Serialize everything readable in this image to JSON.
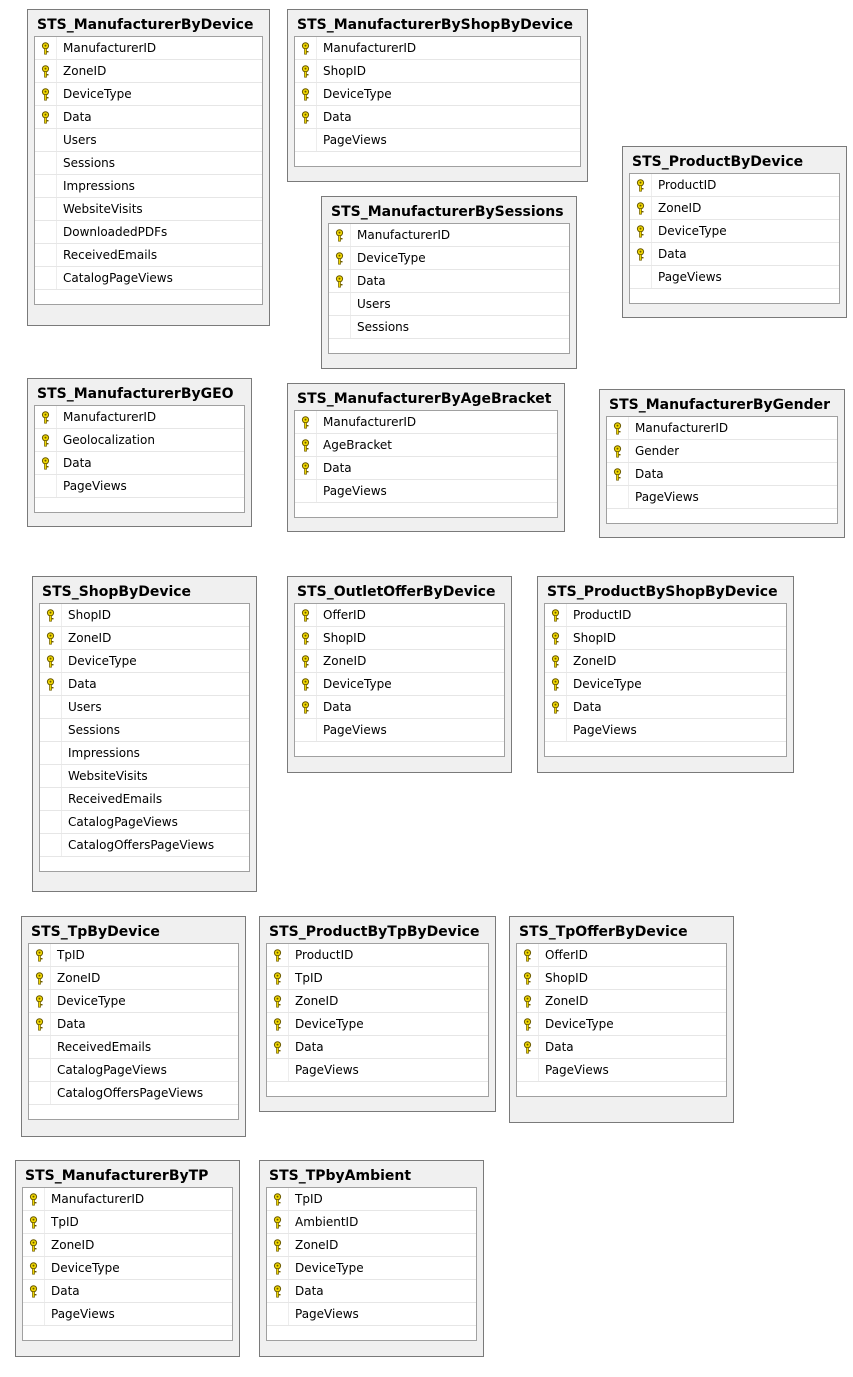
{
  "colors": {
    "key_fill": "#f2d900",
    "key_stroke": "#6b5a00"
  },
  "tables": [
    {
      "name": "STS_ManufacturerByDevice",
      "columns": [
        {
          "name": "ManufacturerID",
          "pk": true
        },
        {
          "name": "ZoneID",
          "pk": true
        },
        {
          "name": "DeviceType",
          "pk": true
        },
        {
          "name": "Data",
          "pk": true
        },
        {
          "name": "Users",
          "pk": false
        },
        {
          "name": "Sessions",
          "pk": false
        },
        {
          "name": "Impressions",
          "pk": false
        },
        {
          "name": "WebsiteVisits",
          "pk": false
        },
        {
          "name": "DownloadedPDFs",
          "pk": false
        },
        {
          "name": "ReceivedEmails",
          "pk": false
        },
        {
          "name": "CatalogPageViews",
          "pk": false
        }
      ]
    },
    {
      "name": "STS_ManufacturerByShopByDevice",
      "columns": [
        {
          "name": "ManufacturerID",
          "pk": true
        },
        {
          "name": "ShopID",
          "pk": true
        },
        {
          "name": "DeviceType",
          "pk": true
        },
        {
          "name": "Data",
          "pk": true
        },
        {
          "name": "PageViews",
          "pk": false
        }
      ]
    },
    {
      "name": "STS_ProductByDevice",
      "columns": [
        {
          "name": "ProductID",
          "pk": true
        },
        {
          "name": "ZoneID",
          "pk": true
        },
        {
          "name": "DeviceType",
          "pk": true
        },
        {
          "name": "Data",
          "pk": true
        },
        {
          "name": "PageViews",
          "pk": false
        }
      ]
    },
    {
      "name": "STS_ManufacturerBySessions",
      "columns": [
        {
          "name": "ManufacturerID",
          "pk": true
        },
        {
          "name": "DeviceType",
          "pk": true
        },
        {
          "name": "Data",
          "pk": true
        },
        {
          "name": "Users",
          "pk": false
        },
        {
          "name": "Sessions",
          "pk": false
        }
      ]
    },
    {
      "name": "STS_ManufacturerByGEO",
      "columns": [
        {
          "name": "ManufacturerID",
          "pk": true
        },
        {
          "name": "Geolocalization",
          "pk": true
        },
        {
          "name": "Data",
          "pk": true
        },
        {
          "name": "PageViews",
          "pk": false
        }
      ]
    },
    {
      "name": "STS_ManufacturerByAgeBracket",
      "columns": [
        {
          "name": "ManufacturerID",
          "pk": true
        },
        {
          "name": "AgeBracket",
          "pk": true
        },
        {
          "name": "Data",
          "pk": true
        },
        {
          "name": "PageViews",
          "pk": false
        }
      ]
    },
    {
      "name": "STS_ManufacturerByGender",
      "columns": [
        {
          "name": "ManufacturerID",
          "pk": true
        },
        {
          "name": "Gender",
          "pk": true
        },
        {
          "name": "Data",
          "pk": true
        },
        {
          "name": "PageViews",
          "pk": false
        }
      ]
    },
    {
      "name": "STS_ShopByDevice",
      "columns": [
        {
          "name": "ShopID",
          "pk": true
        },
        {
          "name": "ZoneID",
          "pk": true
        },
        {
          "name": "DeviceType",
          "pk": true
        },
        {
          "name": "Data",
          "pk": true
        },
        {
          "name": "Users",
          "pk": false
        },
        {
          "name": "Sessions",
          "pk": false
        },
        {
          "name": "Impressions",
          "pk": false
        },
        {
          "name": "WebsiteVisits",
          "pk": false
        },
        {
          "name": "ReceivedEmails",
          "pk": false
        },
        {
          "name": "CatalogPageViews",
          "pk": false
        },
        {
          "name": "CatalogOffersPageViews",
          "pk": false
        }
      ]
    },
    {
      "name": "STS_OutletOfferByDevice",
      "columns": [
        {
          "name": "OfferID",
          "pk": true
        },
        {
          "name": "ShopID",
          "pk": true
        },
        {
          "name": "ZoneID",
          "pk": true
        },
        {
          "name": "DeviceType",
          "pk": true
        },
        {
          "name": "Data",
          "pk": true
        },
        {
          "name": "PageViews",
          "pk": false
        }
      ]
    },
    {
      "name": "STS_ProductByShopByDevice",
      "columns": [
        {
          "name": "ProductID",
          "pk": true
        },
        {
          "name": "ShopID",
          "pk": true
        },
        {
          "name": "ZoneID",
          "pk": true
        },
        {
          "name": "DeviceType",
          "pk": true
        },
        {
          "name": "Data",
          "pk": true
        },
        {
          "name": "PageViews",
          "pk": false
        }
      ]
    },
    {
      "name": "STS_TpByDevice",
      "columns": [
        {
          "name": "TpID",
          "pk": true
        },
        {
          "name": "ZoneID",
          "pk": true
        },
        {
          "name": "DeviceType",
          "pk": true
        },
        {
          "name": "Data",
          "pk": true
        },
        {
          "name": "ReceivedEmails",
          "pk": false
        },
        {
          "name": "CatalogPageViews",
          "pk": false
        },
        {
          "name": "CatalogOffersPageViews",
          "pk": false
        }
      ]
    },
    {
      "name": "STS_ProductByTpByDevice",
      "columns": [
        {
          "name": "ProductID",
          "pk": true
        },
        {
          "name": "TpID",
          "pk": true
        },
        {
          "name": "ZoneID",
          "pk": true
        },
        {
          "name": "DeviceType",
          "pk": true
        },
        {
          "name": "Data",
          "pk": true
        },
        {
          "name": "PageViews",
          "pk": false
        }
      ]
    },
    {
      "name": "STS_TpOfferByDevice",
      "columns": [
        {
          "name": "OfferID",
          "pk": true
        },
        {
          "name": "ShopID",
          "pk": true
        },
        {
          "name": "ZoneID",
          "pk": true
        },
        {
          "name": "DeviceType",
          "pk": true
        },
        {
          "name": "Data",
          "pk": true
        },
        {
          "name": "PageViews",
          "pk": false
        }
      ]
    },
    {
      "name": "STS_ManufacturerByTP",
      "columns": [
        {
          "name": "ManufacturerID",
          "pk": true
        },
        {
          "name": "TpID",
          "pk": true
        },
        {
          "name": "ZoneID",
          "pk": true
        },
        {
          "name": "DeviceType",
          "pk": true
        },
        {
          "name": "Data",
          "pk": true
        },
        {
          "name": "PageViews",
          "pk": false
        }
      ]
    },
    {
      "name": "STS_TPbyAmbient",
      "columns": [
        {
          "name": "TpID",
          "pk": true
        },
        {
          "name": "AmbientID",
          "pk": true
        },
        {
          "name": "ZoneID",
          "pk": true
        },
        {
          "name": "DeviceType",
          "pk": true
        },
        {
          "name": "Data",
          "pk": true
        },
        {
          "name": "PageViews",
          "pk": false
        }
      ]
    }
  ]
}
